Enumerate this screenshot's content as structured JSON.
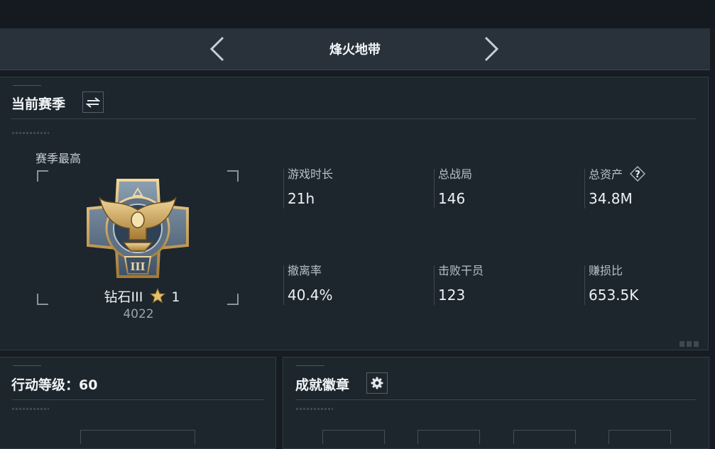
{
  "nav": {
    "title": "烽火地带"
  },
  "current_season": {
    "title": "当前赛季",
    "best_label": "赛季最高",
    "rank_name": "钻石III",
    "rank_stars": "1",
    "rank_score": "4022",
    "rank_numeral": "III",
    "stats": [
      {
        "label": "游戏时长",
        "value": "21h"
      },
      {
        "label": "总战局",
        "value": "146"
      },
      {
        "label": "总资产",
        "value": "34.8M"
      },
      {
        "label": "撤离率",
        "value": "40.4%"
      },
      {
        "label": "击败干员",
        "value": "123"
      },
      {
        "label": "赚损比",
        "value": "653.5K"
      }
    ]
  },
  "action_level": {
    "label": "行动等级：60"
  },
  "badges": {
    "title": "成就徽章"
  },
  "colors": {
    "background": "#161c22",
    "panel": "#1d252d",
    "nav_bar": "#29323b",
    "text": "#e9eef2",
    "gold": "#d8b46a"
  },
  "icons": [
    "chevron-left-icon",
    "chevron-right-icon",
    "swap-icon",
    "help-icon",
    "star-icon",
    "gear-icon",
    "rank-emblem-icon"
  ]
}
